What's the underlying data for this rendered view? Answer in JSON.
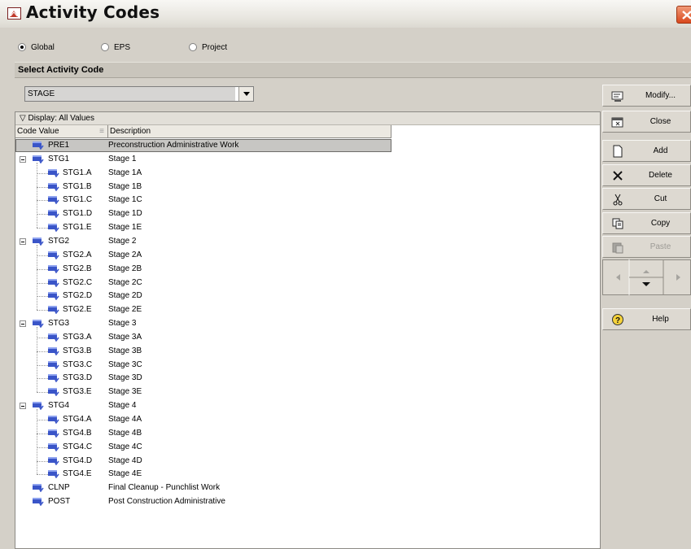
{
  "window": {
    "title": "Activity Codes"
  },
  "scope": {
    "options": [
      {
        "label": "Global",
        "selected": true
      },
      {
        "label": "EPS",
        "selected": false
      },
      {
        "label": "Project",
        "selected": false
      }
    ]
  },
  "select_section": {
    "label": "Select Activity Code",
    "value": "STAGE"
  },
  "grid": {
    "filter_label": "Display: All Values",
    "columns": [
      "Code Value",
      "Description"
    ],
    "rows": [
      {
        "code": "PRE1",
        "desc": "Preconstruction Administrative Work",
        "level": 0,
        "expander": false,
        "selected": true
      },
      {
        "code": "STG1",
        "desc": "Stage 1",
        "level": 0,
        "expander": true
      },
      {
        "code": "STG1.A",
        "desc": "Stage 1A",
        "level": 1
      },
      {
        "code": "STG1.B",
        "desc": "Stage 1B",
        "level": 1
      },
      {
        "code": "STG1.C",
        "desc": "Stage 1C",
        "level": 1
      },
      {
        "code": "STG1.D",
        "desc": "Stage 1D",
        "level": 1
      },
      {
        "code": "STG1.E",
        "desc": "Stage 1E",
        "level": 1
      },
      {
        "code": "STG2",
        "desc": "Stage 2",
        "level": 0,
        "expander": true
      },
      {
        "code": "STG2.A",
        "desc": "Stage 2A",
        "level": 1
      },
      {
        "code": "STG2.B",
        "desc": "Stage 2B",
        "level": 1
      },
      {
        "code": "STG2.C",
        "desc": "Stage 2C",
        "level": 1
      },
      {
        "code": "STG2.D",
        "desc": "Stage 2D",
        "level": 1
      },
      {
        "code": "STG2.E",
        "desc": "Stage 2E",
        "level": 1
      },
      {
        "code": "STG3",
        "desc": "Stage 3",
        "level": 0,
        "expander": true
      },
      {
        "code": "STG3.A",
        "desc": "Stage 3A",
        "level": 1
      },
      {
        "code": "STG3.B",
        "desc": "Stage 3B",
        "level": 1
      },
      {
        "code": "STG3.C",
        "desc": "Stage 3C",
        "level": 1
      },
      {
        "code": "STG3.D",
        "desc": "Stage 3D",
        "level": 1
      },
      {
        "code": "STG3.E",
        "desc": "Stage 3E",
        "level": 1
      },
      {
        "code": "STG4",
        "desc": "Stage 4",
        "level": 0,
        "expander": true
      },
      {
        "code": "STG4.A",
        "desc": "Stage 4A",
        "level": 1
      },
      {
        "code": "STG4.B",
        "desc": "Stage 4B",
        "level": 1
      },
      {
        "code": "STG4.C",
        "desc": "Stage 4C",
        "level": 1
      },
      {
        "code": "STG4.D",
        "desc": "Stage 4D",
        "level": 1
      },
      {
        "code": "STG4.E",
        "desc": "Stage 4E",
        "level": 1
      },
      {
        "code": "CLNP",
        "desc": "Final Cleanup - Punchlist Work",
        "level": 0,
        "expander": false
      },
      {
        "code": "POST",
        "desc": "Post Construction Administrative",
        "level": 0,
        "expander": false
      }
    ]
  },
  "toolbar": {
    "modify": "Modify...",
    "close": "Close",
    "add": "Add",
    "delete": "Delete",
    "cut": "Cut",
    "copy": "Copy",
    "paste": "Paste",
    "help": "Help"
  },
  "colors": {
    "selected_row": "#c7c6c3",
    "dialog_bg": "#d4d0c8",
    "code_icon": "#3a55c8"
  }
}
